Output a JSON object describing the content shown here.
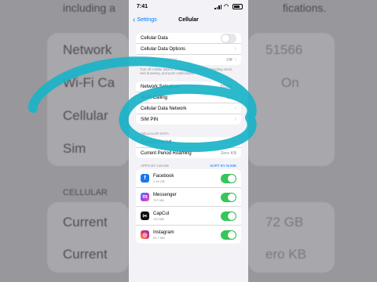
{
  "background": {
    "top_text": "including a",
    "top_text_right": "fications.",
    "rows": [
      {
        "label": "Network",
        "value": "51566"
      },
      {
        "label": "Wi-Fi Ca",
        "value": "On"
      },
      {
        "label": "Cellular",
        "value": ""
      },
      {
        "label": "Sim",
        "value": ""
      }
    ],
    "section": "CELLULAR",
    "bottom_rows": [
      {
        "label": "Current",
        "value": "72 GB"
      },
      {
        "label": "Current",
        "value": "ero KB"
      }
    ]
  },
  "status_bar": {
    "time": "7:41"
  },
  "nav": {
    "back_label": "Settings",
    "title": "Cellular"
  },
  "group1": {
    "cellular_data": "Cellular Data",
    "cellular_data_options": "Cellular Data Options",
    "personal_hotspot": "Personal Hotspot",
    "personal_hotspot_value": "Off"
  },
  "footnote": "Turn off cellular data to restrict all data to Wi-Fi, including email, web browsing, and push notifications.",
  "group2": {
    "network_selection": "Network Selection",
    "network_selection_value": "51566",
    "wifi_calling": "Wi-Fi Calling",
    "wifi_calling_value": "On",
    "cellular_data_network": "Cellular Data Network",
    "sim_pin": "SIM PIN"
  },
  "usage": {
    "header": "CELLULAR DATA",
    "current_period": "Current Period",
    "current_period_value": "2.72 GB",
    "current_period_roaming": "Current Period Roaming",
    "current_period_roaming_value": "Zero KB"
  },
  "apps_header": {
    "label": "APPS BY USAGE",
    "sort": "SORT BY NAME"
  },
  "apps": [
    {
      "name": "Facebook",
      "size": "1.16 GB",
      "icon": "facebook-icon",
      "color": "#1877f2",
      "glyph": "f"
    },
    {
      "name": "Messenger",
      "size": "797 MB",
      "icon": "messenger-icon",
      "color": "#8a3ffc",
      "glyph": "m"
    },
    {
      "name": "CapCut",
      "size": "132 MB",
      "icon": "capcut-icon",
      "color": "#111111",
      "glyph": "✂"
    },
    {
      "name": "Instagram",
      "size": "94.7 MB",
      "icon": "instagram-icon",
      "color": "#d6287a",
      "glyph": "◎"
    }
  ],
  "colors": {
    "accent": "#007aff",
    "toggle_on": "#34c759",
    "annotation": "#1ab3c8"
  }
}
